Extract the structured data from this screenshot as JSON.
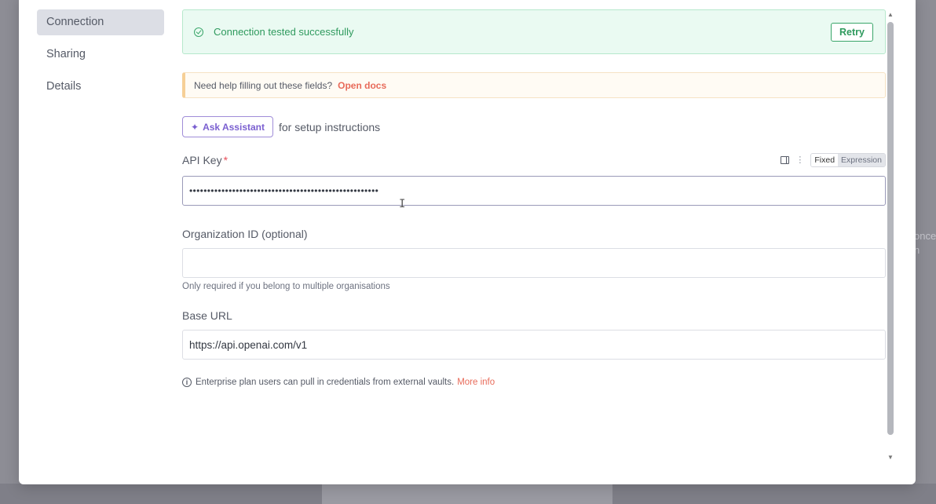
{
  "sidebar": {
    "items": [
      {
        "label": "Connection",
        "active": true
      },
      {
        "label": "Sharing",
        "active": false
      },
      {
        "label": "Details",
        "active": false
      }
    ]
  },
  "success_banner": {
    "message": "Connection tested successfully",
    "retry_label": "Retry"
  },
  "help_banner": {
    "text": "Need help filling out these fields?",
    "link": "Open docs"
  },
  "assistant": {
    "button_label": "Ask Assistant",
    "note": "for setup instructions"
  },
  "api_key": {
    "label": "API Key",
    "required_mark": "*",
    "value_masked": "•••••••••••••••••••••••••••••••••••••••••••••••••••••",
    "mode_fixed": "Fixed",
    "mode_expression": "Expression"
  },
  "organization": {
    "label": "Organization ID (optional)",
    "value": "",
    "hint": "Only required if you belong to multiple organisations"
  },
  "base_url": {
    "label": "Base URL",
    "value": "https://api.openai.com/v1"
  },
  "footer_info": {
    "text": "Enterprise plan users can pull in credentials from external vaults.",
    "link": "More info",
    "icon_glyph": "i"
  },
  "background": {
    "text_line1": "once",
    "text_line2": "n"
  },
  "colors": {
    "success": "#2f9a5e",
    "link": "#e86b5a",
    "assistant": "#7a5fd0"
  }
}
